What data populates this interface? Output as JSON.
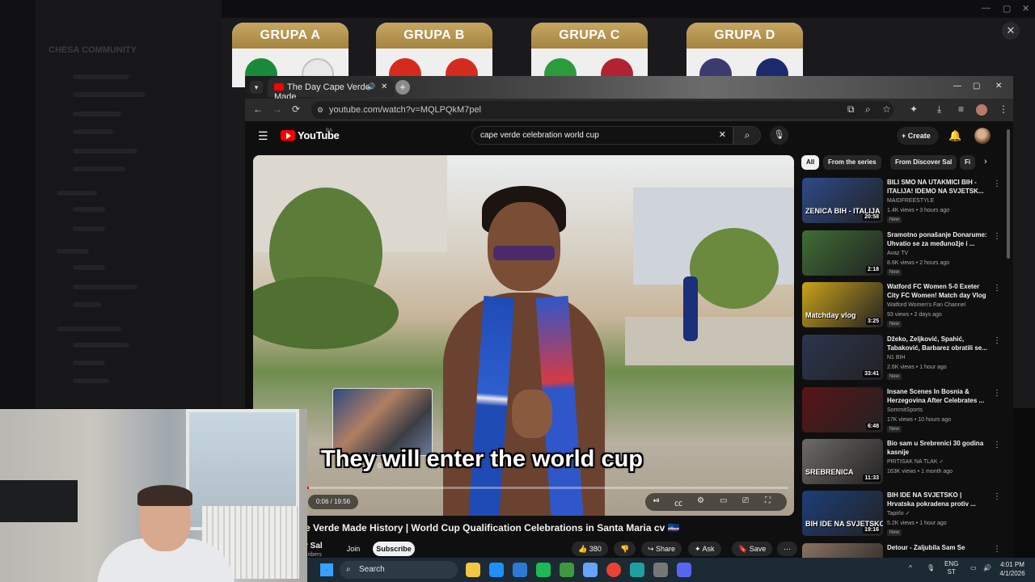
{
  "discord": {
    "server_name": "CHESA COMMUNITY",
    "window_controls": [
      "—",
      "▢",
      "✕"
    ]
  },
  "groups": [
    {
      "label": "GRUPA A",
      "flags": [
        "#1a8a3a",
        "#e8e8e8"
      ]
    },
    {
      "label": "GRUPA B",
      "flags": [
        "#d52b1e",
        "#d52b1e"
      ]
    },
    {
      "label": "GRUPA C",
      "flags": [
        "#2a9d3a",
        "#b22234"
      ]
    },
    {
      "label": "GRUPA D",
      "flags": [
        "#3c3b6e",
        "#1b2a6b"
      ]
    }
  ],
  "overlay_close": "✕",
  "browser": {
    "tab_title": "The Day Cape Verde Made",
    "tab_icons": {
      "audio": "🔊",
      "close": "✕"
    },
    "new_tab": "+",
    "url": "youtube.com/watch?v=MQLPQkM7pel",
    "nav": {
      "back": "←",
      "forward": "→",
      "reload": "⟳"
    },
    "window_controls": [
      "—",
      "▢",
      "✕"
    ]
  },
  "youtube": {
    "logo_text": "YouTube",
    "country": "BA",
    "search_query": "cape verde celebration world cup",
    "create_label": "Create",
    "video": {
      "caption": "They will enter the world cup",
      "preview_time": "0:38",
      "time": "0:06 / 19:56",
      "progress": 0.005,
      "title": "e Verde Made History | World Cup Qualification Celebrations in Santa Maria cv 🇨🇻",
      "channel": "r Sal",
      "channel_sub": "cribers",
      "join": "Join",
      "subscribe": "Subscribe",
      "likes": "380",
      "share": "Share",
      "ask": "Ask",
      "save": "Save"
    },
    "chips": [
      "All",
      "From the series",
      "From Discover Sal",
      "Fi"
    ],
    "recommendations": [
      {
        "title": "BILI SMO NA UTAKMICI BIH - ITALIJA! IDEMO NA SVJETSK...",
        "channel": "MAIDFREESTYLE",
        "meta": "1.4K views • 3 hours ago",
        "badge": "New",
        "duration": "20:58",
        "thumb_color": "#2d4a8a",
        "thumb_label": "ZENICA  BIH - ITALIJA"
      },
      {
        "title": "Sramotno ponašanje Donarume: Uhvatio se za međunožje i ...",
        "channel": "Avaz TV",
        "meta": "8.6K views • 2 hours ago",
        "badge": "New",
        "duration": "2:18",
        "thumb_color": "#3f6e35",
        "thumb_label": ""
      },
      {
        "title": "Watford FC Women 5-0 Exeter City FC Women! Match day Vlog",
        "channel": "Watford Women's Fan Channel",
        "meta": "93 views • 2 days ago",
        "badge": "New",
        "duration": "3:25",
        "thumb_color": "#c9a21a",
        "thumb_label": "Matchday vlog"
      },
      {
        "title": "Džeko, Zeljković, Spahić, Tabaković, Barbarez obratili se...",
        "channel": "N1 BIH",
        "meta": "2.6K views • 1 hour ago",
        "badge": "New",
        "duration": "33:41",
        "thumb_color": "#2c3550",
        "thumb_label": ""
      },
      {
        "title": "Insane Scenes In Bosnia & Herzegovina After Celebrates ...",
        "channel": "SommitSports",
        "meta": "17K views • 10 hours ago",
        "badge": "New",
        "duration": "6:48",
        "thumb_color": "#5a1418",
        "thumb_label": ""
      },
      {
        "title": "Bio sam u Srebrenici 30 godina kasnije",
        "channel": "PRITISAK NA TLAK ✓",
        "meta": "163K views • 1 month ago",
        "badge": "",
        "duration": "11:33",
        "thumb_color": "#6d6b66",
        "thumb_label": "SREBRENICA"
      },
      {
        "title": "BIH IDE NA SVJETSKO | Hrvatska pokradena protiv ...",
        "channel": "Tapirlo ✓",
        "meta": "5.2K views • 1 hour ago",
        "badge": "New",
        "duration": "19:16",
        "thumb_color": "#1d3e7a",
        "thumb_label": "BIH IDE NA SVJETSKO"
      },
      {
        "title": "Detour - Zaljubila Sam Se",
        "channel": "",
        "meta": "",
        "badge": "",
        "duration": "",
        "thumb_color": "#8a7260",
        "thumb_label": ""
      }
    ]
  },
  "taskbar": {
    "search_label": "Search",
    "lang_top": "ENG",
    "lang_bottom": "ST",
    "time": "4:01 PM",
    "date": "4/1/2026",
    "apps": [
      "#f2c744",
      "#1e90ff",
      "#2b7bd6",
      "#1db954",
      "#3c9a3c",
      "#66a3ff",
      "#ea4335",
      "#1ea0a0",
      "#777777",
      "#5865f2"
    ]
  }
}
